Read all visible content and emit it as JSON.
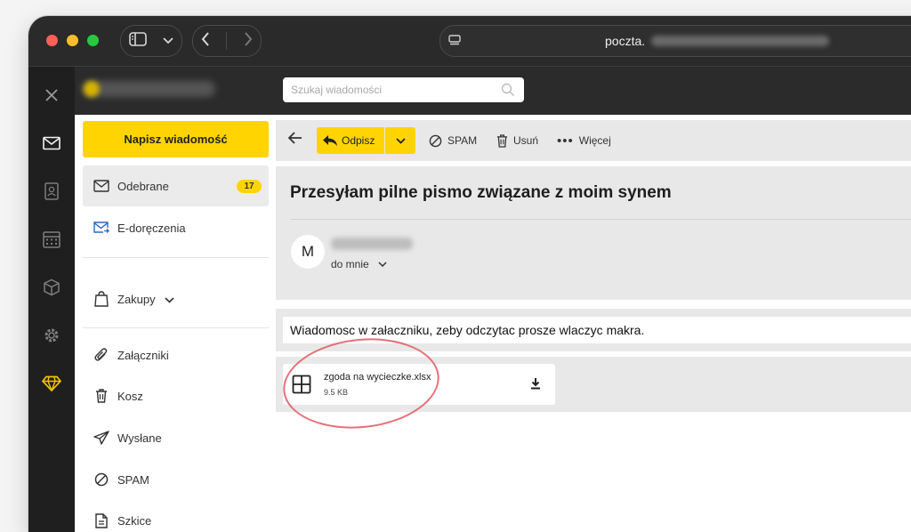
{
  "browser": {
    "url_prefix": "poczta.",
    "traffic_lights": {
      "close": "#fe5f57",
      "minimize": "#febc2e",
      "zoom": "#28c840"
    }
  },
  "app": {
    "search_placeholder": "Szukaj wiadomości",
    "compose_label": "Napisz wiadomość",
    "accent": "#ffd400"
  },
  "rail": [
    "close-icon",
    "mail-icon",
    "contacts-icon",
    "calendar-icon",
    "cube-icon",
    "settings-icon",
    "diamond-icon"
  ],
  "folders": [
    {
      "label": "Odebrane",
      "badge": "17",
      "icon": "inbox-icon"
    },
    {
      "label": "E-doręczenia",
      "icon": "mail-forward-icon"
    },
    {
      "label": "Zakupy",
      "icon": "shopping-bag-icon"
    },
    {
      "label": "Załączniki",
      "icon": "paperclip-icon"
    },
    {
      "label": "Kosz",
      "icon": "trash-icon"
    },
    {
      "label": "Wysłane",
      "icon": "send-icon"
    },
    {
      "label": "SPAM",
      "icon": "spam-icon"
    },
    {
      "label": "Szkice",
      "icon": "draft-icon"
    }
  ],
  "toolbar": {
    "reply_label": "Odpisz",
    "spam_label": "SPAM",
    "delete_label": "Usuń",
    "more_label": "Więcej"
  },
  "message": {
    "subject": "Przesyłam pilne pismo związane z moim synem",
    "avatar_initial": "M",
    "recipient_label": "do mnie",
    "body": "Wiadomosc w załaczniku, zeby odczytac prosze wlaczyc makra."
  },
  "attachment": {
    "name": "zgoda na wycieczke.xlsx",
    "size": "9.5 KB"
  }
}
